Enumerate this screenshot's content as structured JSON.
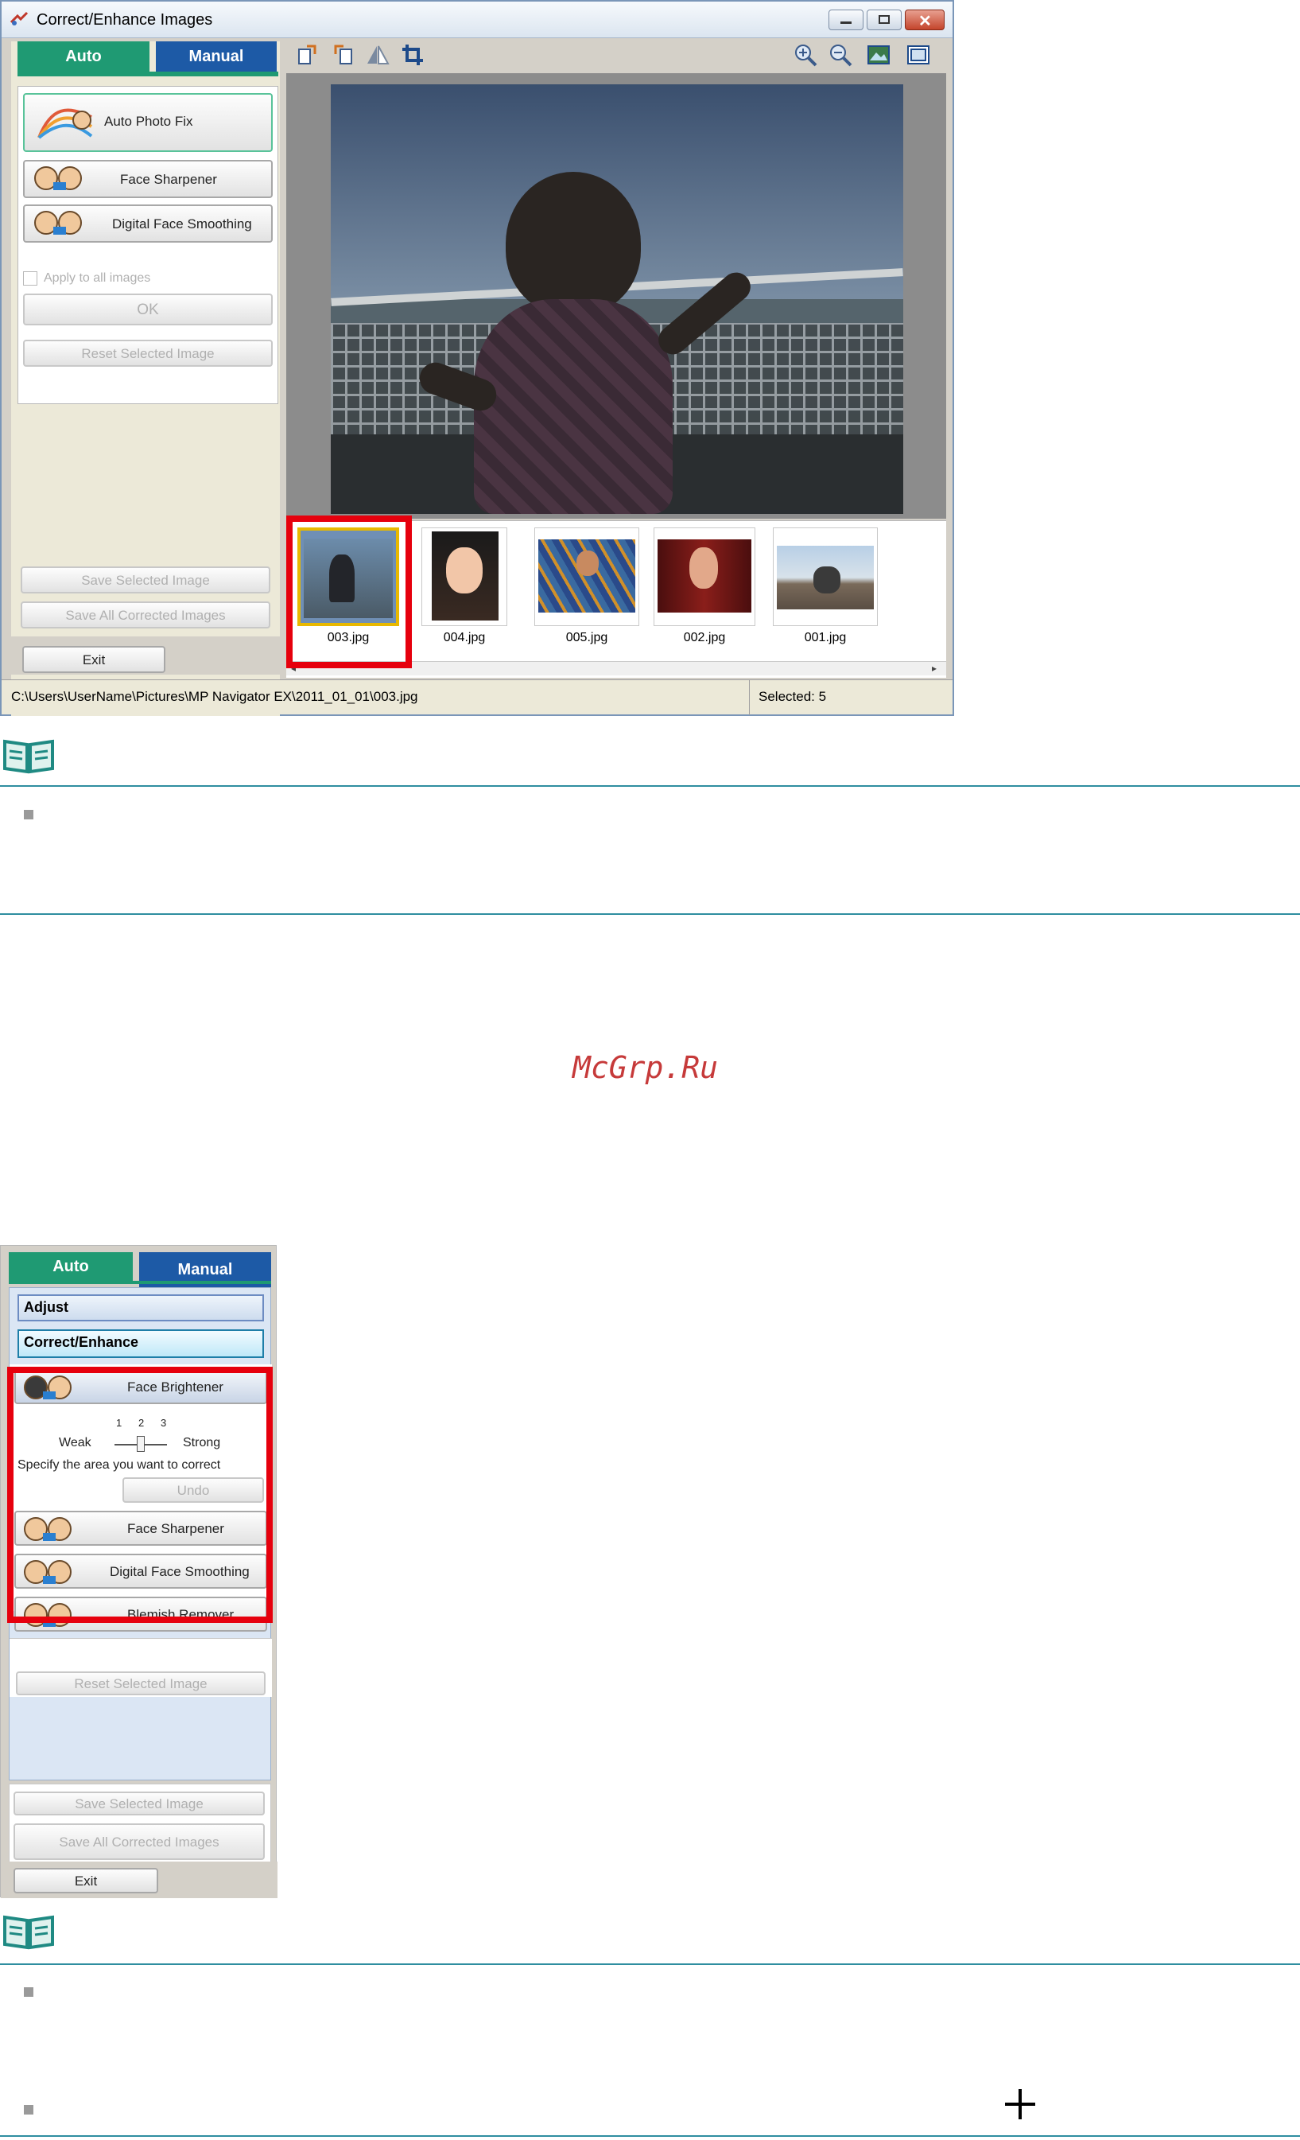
{
  "window1": {
    "title": "Correct/Enhance Images",
    "tabs": {
      "auto": "Auto",
      "manual": "Manual"
    },
    "auto_buttons": [
      {
        "label": "Auto Photo Fix",
        "icon": "auto-photo-fix-icon"
      },
      {
        "label": "Face Sharpener",
        "icon": "face-sharpener-icon"
      },
      {
        "label": "Digital Face Smoothing",
        "icon": "digital-face-smoothing-icon"
      }
    ],
    "apply_all_label": "Apply to all images",
    "ok_label": "OK",
    "reset_label": "Reset Selected Image",
    "save_selected_label": "Save Selected Image",
    "save_all_label": "Save All Corrected Images",
    "exit_label": "Exit",
    "toolbar_left": [
      "rotate-left-icon",
      "rotate-right-icon",
      "flip-icon",
      "crop-icon"
    ],
    "toolbar_right": [
      "zoom-in-icon",
      "zoom-out-icon",
      "full-image-icon",
      "compare-icon"
    ],
    "thumbnails": [
      "003.jpg",
      "004.jpg",
      "005.jpg",
      "002.jpg",
      "001.jpg"
    ],
    "status_path": "C:\\Users\\UserName\\Pictures\\MP Navigator EX\\2011_01_01\\003.jpg",
    "status_selected": "Selected: 5"
  },
  "watermark": "McGrp.Ru",
  "window2": {
    "tabs": {
      "auto": "Auto",
      "manual": "Manual"
    },
    "sections": {
      "adjust": "Adjust",
      "correct": "Correct/Enhance"
    },
    "face_brightener": "Face Brightener",
    "slider": {
      "weak": "Weak",
      "strong": "Strong",
      "ticks": [
        "1",
        "2",
        "3"
      ],
      "value": 2
    },
    "specify_text": "Specify the area you want to correct",
    "undo_label": "Undo",
    "tools": [
      {
        "label": "Face Sharpener",
        "icon": "face-sharpener-icon"
      },
      {
        "label": "Digital Face Smoothing",
        "icon": "digital-face-smoothing-icon"
      },
      {
        "label": "Blemish Remover",
        "icon": "blemish-remover-icon"
      }
    ],
    "reset_label": "Reset Selected Image",
    "save_selected_label": "Save Selected Image",
    "save_all_label": "Save All Corrected Images",
    "exit_label": "Exit"
  },
  "colors": {
    "auto_tab": "#1f9a73",
    "manual_tab": "#1d5aa6",
    "highlight": "#e6000d",
    "note_rule": "#2f8ea0"
  }
}
